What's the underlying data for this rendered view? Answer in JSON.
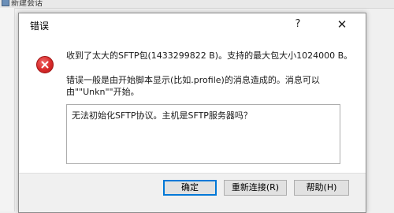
{
  "parent": {
    "title": "新建会话"
  },
  "dialog": {
    "title": "错误",
    "help_glyph": "?",
    "close_glyph": "✕",
    "message_line1": "收到了太大的SFTP包(1433299822 B)。支持的最大包大小1024000 B。",
    "message_line2": "错误一般是由开始脚本显示(比如.profile)的消息造成的。消息可以由\"\"Unkn\"\"开始。",
    "details_text": "无法初始化SFTP协议。主机是SFTP服务器吗？",
    "buttons": {
      "ok": "确定",
      "reconnect": "重新连接(R)",
      "help": "帮助(H)"
    },
    "icon": "error-icon",
    "colors": {
      "error_red": "#d82a2a",
      "focus_blue": "#0078d7"
    }
  }
}
